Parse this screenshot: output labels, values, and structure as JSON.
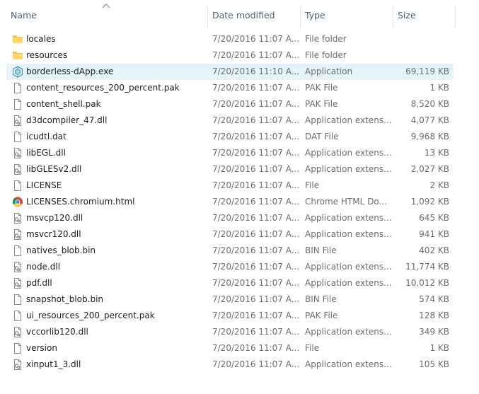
{
  "columns": {
    "name": "Name",
    "date": "Date modified",
    "type": "Type",
    "size": "Size"
  },
  "files": [
    {
      "name": "locales",
      "date": "7/20/2016 11:07 A...",
      "type": "File folder",
      "size": "",
      "icon": "folder-icon"
    },
    {
      "name": "resources",
      "date": "7/20/2016 11:07 A...",
      "type": "File folder",
      "size": "",
      "icon": "folder-icon"
    },
    {
      "name": "borderless-dApp.exe",
      "date": "7/20/2016 11:10 A...",
      "type": "Application",
      "size": "69,119 KB",
      "icon": "app-icon",
      "selected": true
    },
    {
      "name": "content_resources_200_percent.pak",
      "date": "7/20/2016 11:07 A...",
      "type": "PAK File",
      "size": "1 KB",
      "icon": "file-icon"
    },
    {
      "name": "content_shell.pak",
      "date": "7/20/2016 11:07 A...",
      "type": "PAK File",
      "size": "8,520 KB",
      "icon": "file-icon"
    },
    {
      "name": "d3dcompiler_47.dll",
      "date": "7/20/2016 11:07 A...",
      "type": "Application extens...",
      "size": "4,077 KB",
      "icon": "dll-icon"
    },
    {
      "name": "icudtl.dat",
      "date": "7/20/2016 11:07 A...",
      "type": "DAT File",
      "size": "9,968 KB",
      "icon": "file-icon"
    },
    {
      "name": "libEGL.dll",
      "date": "7/20/2016 11:07 A...",
      "type": "Application extens...",
      "size": "13 KB",
      "icon": "dll-icon"
    },
    {
      "name": "libGLESv2.dll",
      "date": "7/20/2016 11:07 A...",
      "type": "Application extens...",
      "size": "2,027 KB",
      "icon": "dll-icon"
    },
    {
      "name": "LICENSE",
      "date": "7/20/2016 11:07 A...",
      "type": "File",
      "size": "2 KB",
      "icon": "file-icon"
    },
    {
      "name": "LICENSES.chromium.html",
      "date": "7/20/2016 11:07 A...",
      "type": "Chrome HTML Do...",
      "size": "1,092 KB",
      "icon": "chrome-icon"
    },
    {
      "name": "msvcp120.dll",
      "date": "7/20/2016 11:07 A...",
      "type": "Application extens...",
      "size": "645 KB",
      "icon": "dll-icon"
    },
    {
      "name": "msvcr120.dll",
      "date": "7/20/2016 11:07 A...",
      "type": "Application extens...",
      "size": "941 KB",
      "icon": "dll-icon"
    },
    {
      "name": "natives_blob.bin",
      "date": "7/20/2016 11:07 A...",
      "type": "BIN File",
      "size": "402 KB",
      "icon": "file-icon"
    },
    {
      "name": "node.dll",
      "date": "7/20/2016 11:07 A...",
      "type": "Application extens...",
      "size": "11,774 KB",
      "icon": "dll-icon"
    },
    {
      "name": "pdf.dll",
      "date": "7/20/2016 11:07 A...",
      "type": "Application extens...",
      "size": "10,012 KB",
      "icon": "dll-icon"
    },
    {
      "name": "snapshot_blob.bin",
      "date": "7/20/2016 11:07 A...",
      "type": "BIN File",
      "size": "574 KB",
      "icon": "file-icon"
    },
    {
      "name": "ui_resources_200_percent.pak",
      "date": "7/20/2016 11:07 A...",
      "type": "PAK File",
      "size": "128 KB",
      "icon": "file-icon"
    },
    {
      "name": "vccorlib120.dll",
      "date": "7/20/2016 11:07 A...",
      "type": "Application extens...",
      "size": "349 KB",
      "icon": "dll-icon"
    },
    {
      "name": "version",
      "date": "7/20/2016 11:07 A...",
      "type": "File",
      "size": "1 KB",
      "icon": "file-icon"
    },
    {
      "name": "xinput1_3.dll",
      "date": "7/20/2016 11:07 A...",
      "type": "Application extens...",
      "size": "105 KB",
      "icon": "dll-icon"
    }
  ],
  "colors": {
    "selection": "#e5f3fb",
    "folder": "#f5c54a",
    "header_text": "#4c607a",
    "secondary_text": "#6d6d6d"
  }
}
